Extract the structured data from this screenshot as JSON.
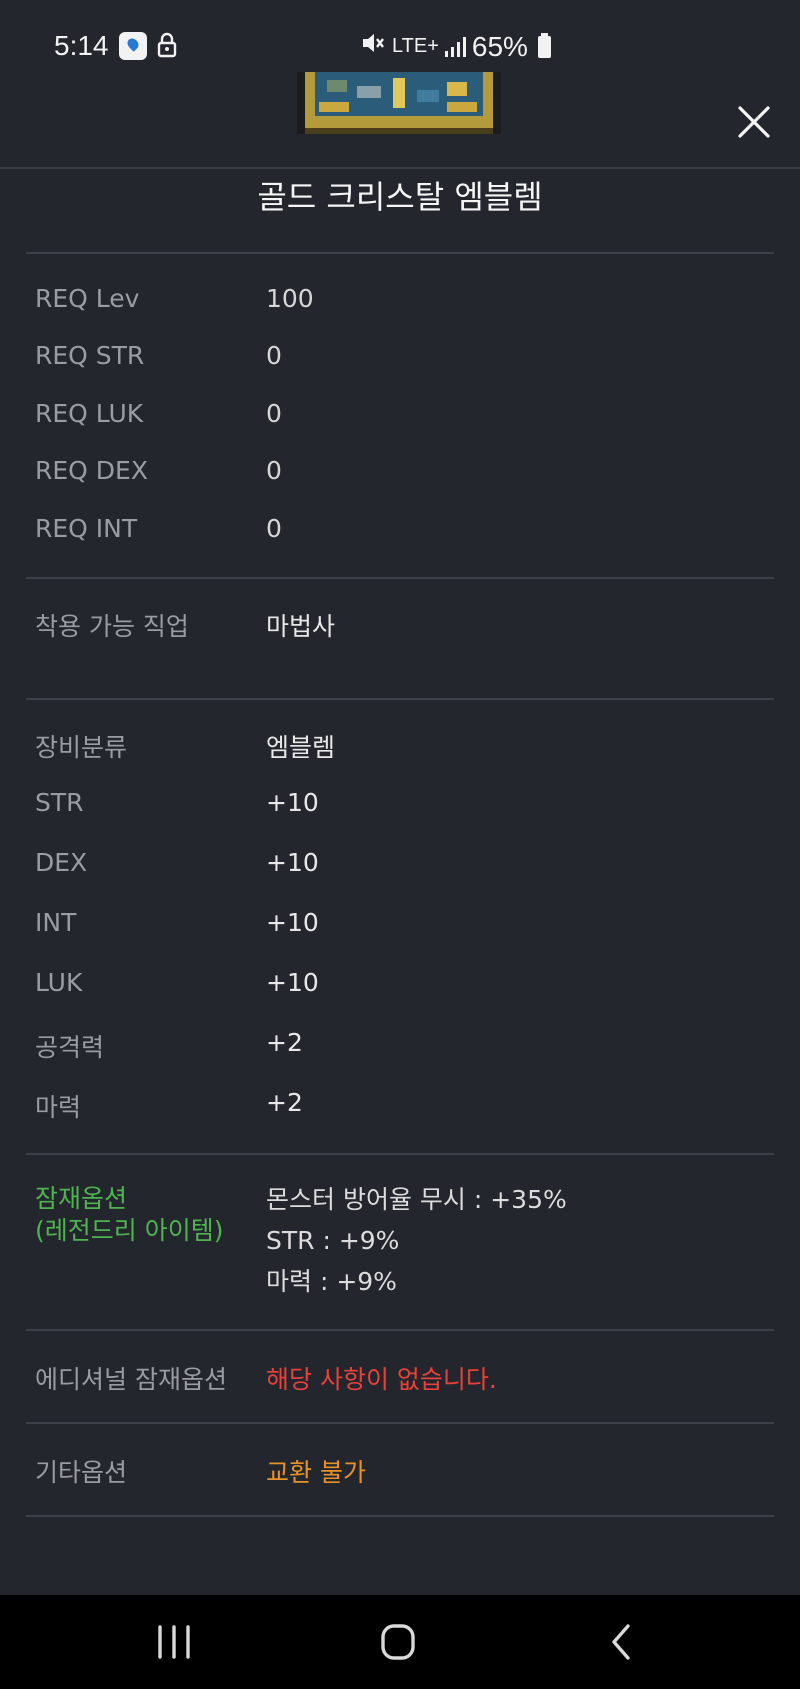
{
  "status_bar": {
    "time": "5:14",
    "network": "LTE+",
    "battery_percent": "65%",
    "icons": [
      "maps-icon",
      "lock-icon",
      "mute-icon",
      "signal-icon",
      "battery-icon"
    ]
  },
  "item": {
    "title": "골드 크리스탈 엠블렘"
  },
  "requirements": [
    {
      "label": "REQ Lev",
      "value": "100"
    },
    {
      "label": "REQ STR",
      "value": "0"
    },
    {
      "label": "REQ LUK",
      "value": "0"
    },
    {
      "label": "REQ DEX",
      "value": "0"
    },
    {
      "label": "REQ INT",
      "value": "0"
    }
  ],
  "job": {
    "label": "착용 가능 직업",
    "value": "마법사"
  },
  "stats": [
    {
      "label": "장비분류",
      "value": "엠블렘"
    },
    {
      "label": "STR",
      "value": "+10"
    },
    {
      "label": "DEX",
      "value": "+10"
    },
    {
      "label": "INT",
      "value": "+10"
    },
    {
      "label": "LUK",
      "value": "+10"
    },
    {
      "label": "공격력",
      "value": "+2"
    },
    {
      "label": "마력",
      "value": "+2"
    }
  ],
  "potential": {
    "label_line1": "잠재옵션",
    "label_line2": "(레전드리 아이템)",
    "lines": [
      "몬스터 방어율 무시 : +35%",
      "STR : +9%",
      "마력 : +9%"
    ]
  },
  "additional_potential": {
    "label": "에디셔널 잠재옵션",
    "value": "해당 사항이 없습니다."
  },
  "other_options": {
    "label": "기타옵션",
    "value": "교환 불가"
  },
  "colors": {
    "background": "#23262d",
    "label": "#9a9ca3",
    "potential_green": "#4fb34f",
    "none_red": "#e8403a",
    "other_orange": "#e89128"
  }
}
